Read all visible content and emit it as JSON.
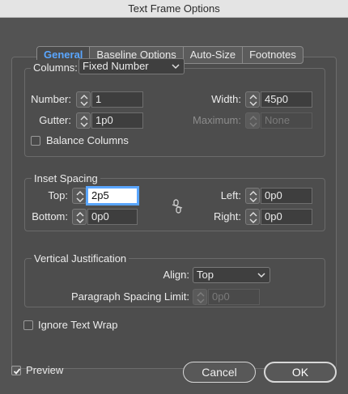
{
  "window": {
    "title": "Text Frame Options"
  },
  "tabs": [
    {
      "label": "General",
      "active": true
    },
    {
      "label": "Baseline Options",
      "active": false
    },
    {
      "label": "Auto-Size",
      "active": false
    },
    {
      "label": "Footnotes",
      "active": false
    }
  ],
  "columns": {
    "label": "Columns:",
    "type_value": "Fixed Number",
    "number_label": "Number:",
    "number_value": "1",
    "width_label": "Width:",
    "width_value": "45p0",
    "gutter_label": "Gutter:",
    "gutter_value": "1p0",
    "maximum_label": "Maximum:",
    "maximum_value": "None",
    "balance_label": "Balance Columns",
    "balance_checked": false
  },
  "inset": {
    "title": "Inset Spacing",
    "top_label": "Top:",
    "top_value": "2p5",
    "bottom_label": "Bottom:",
    "bottom_value": "0p0",
    "left_label": "Left:",
    "left_value": "0p0",
    "right_label": "Right:",
    "right_value": "0p0",
    "link_icon": "broken-link-icon"
  },
  "vertical": {
    "title": "Vertical Justification",
    "align_label": "Align:",
    "align_value": "Top",
    "spacing_label": "Paragraph Spacing Limit:",
    "spacing_value": "0p0"
  },
  "ignore_wrap": {
    "label": "Ignore Text Wrap",
    "checked": false
  },
  "footer": {
    "preview_label": "Preview",
    "preview_checked": true,
    "cancel_label": "Cancel",
    "ok_label": "OK"
  },
  "colors": {
    "background": "#535353",
    "accent": "#5aa6ff",
    "text": "#ececec"
  }
}
